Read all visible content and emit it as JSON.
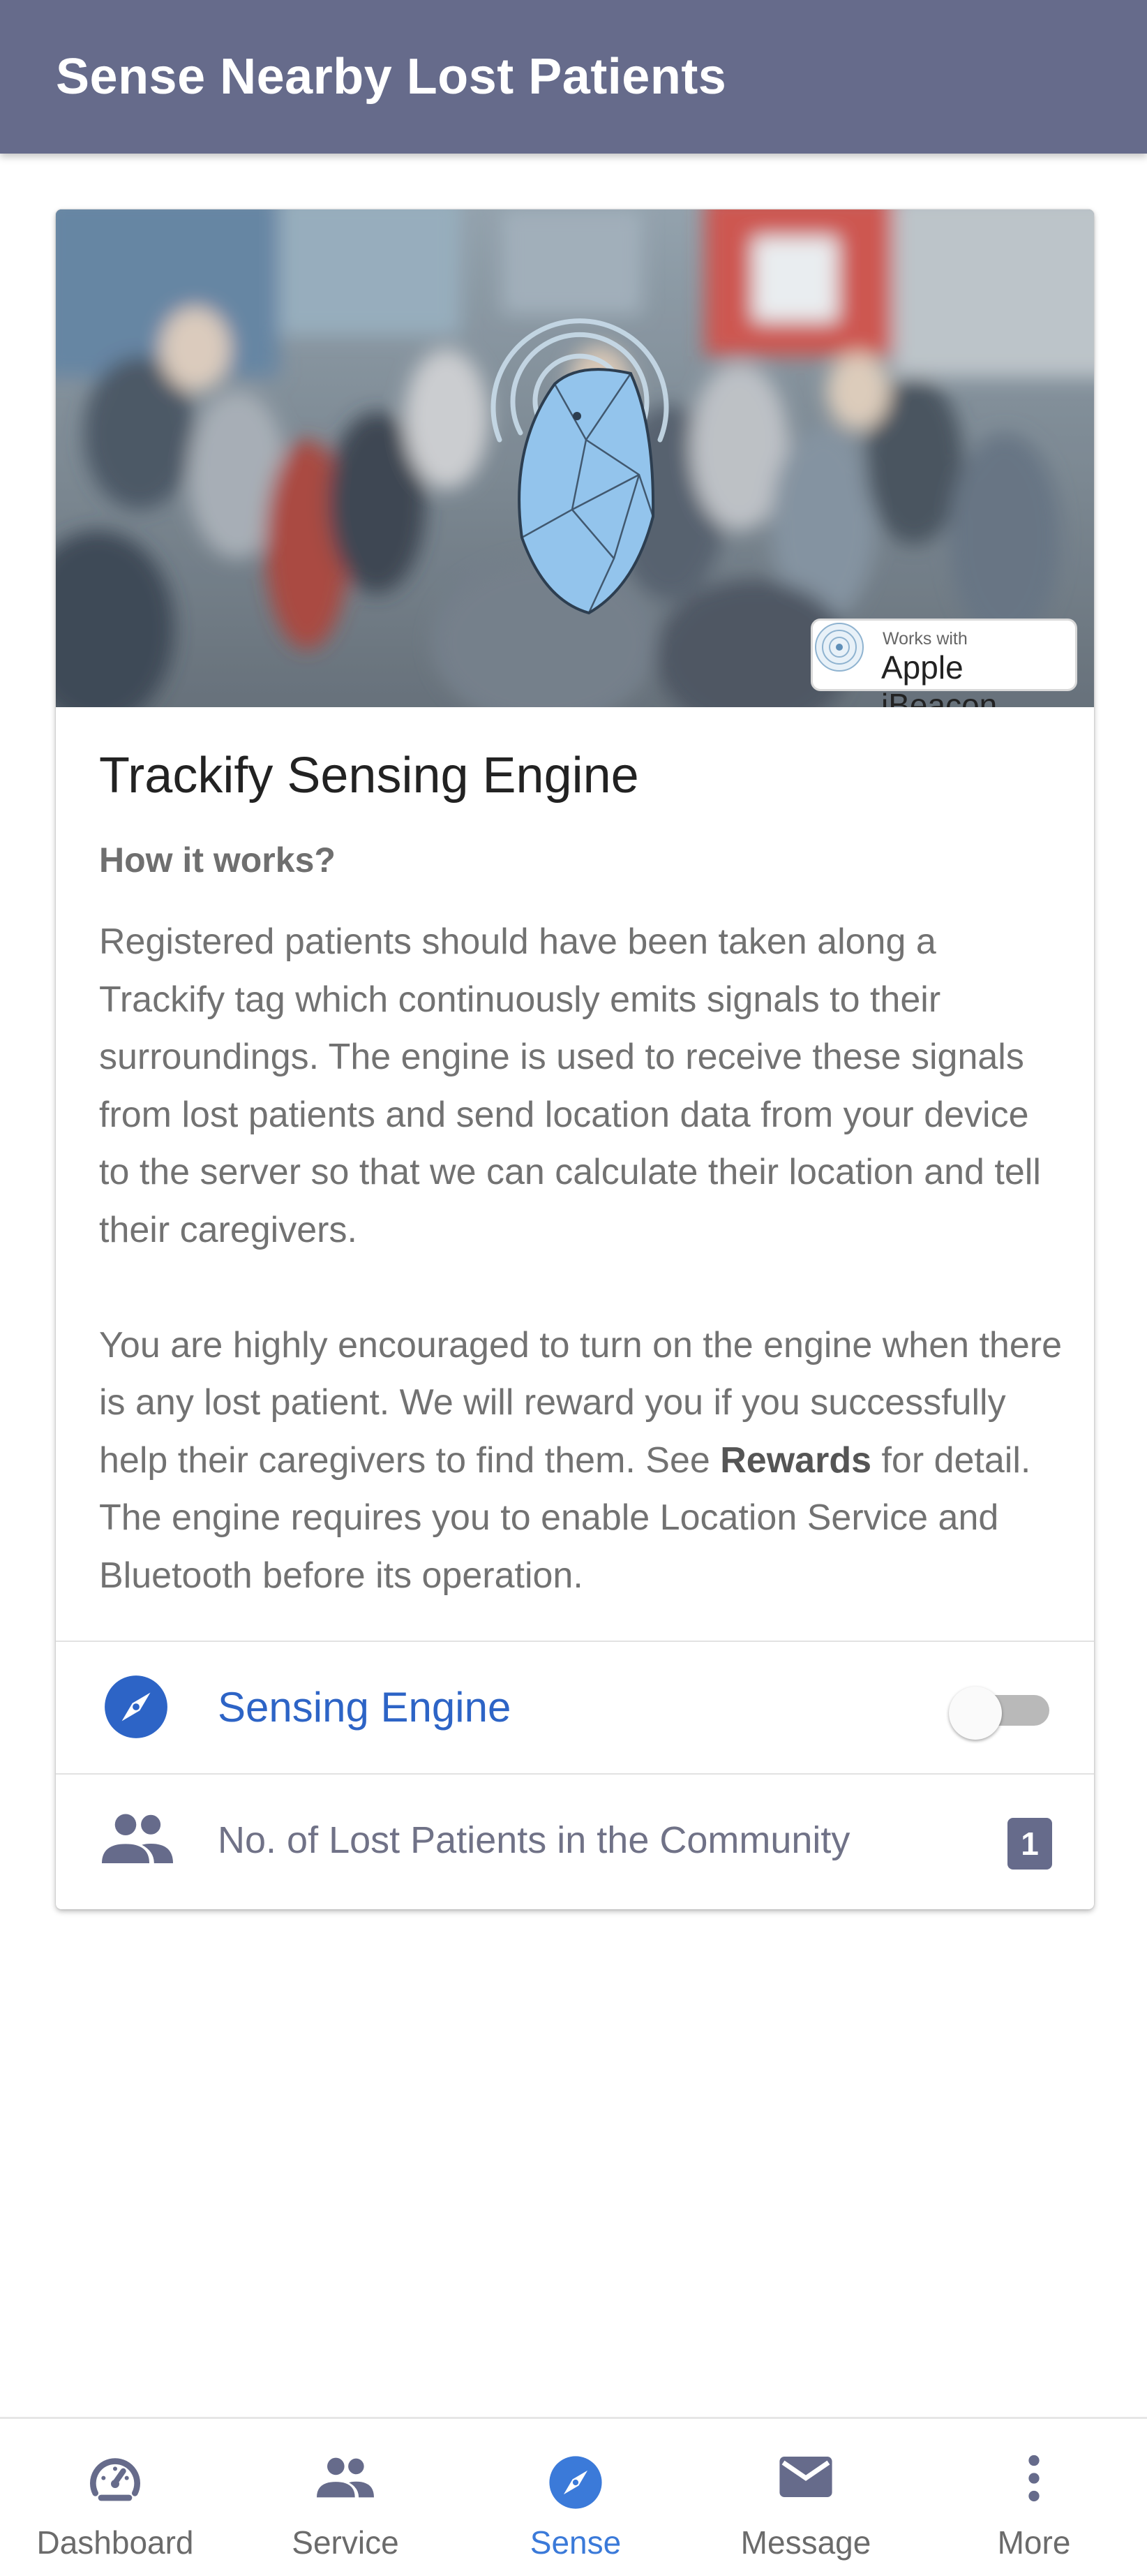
{
  "app_bar": {
    "title": "Sense Nearby Lost Patients"
  },
  "hero": {
    "badge_small": "Works with",
    "badge_big": "Apple iBeacon",
    "beacon_color": "#93c4ec"
  },
  "card": {
    "title": "Trackify Sensing Engine",
    "subtitle": "How it works?",
    "paragraph1": "Registered patients should have been taken along a Trackify tag which continuously emits signals to their surroundings. The engine is used to receive these signals from lost patients and send location data from your device to the server so that we can calculate their location and tell their caregivers.",
    "paragraph2_before": "You are highly encouraged to turn on the engine when there is any lost patient. We will reward you if you successfully help their caregivers to find them. See ",
    "paragraph2_bold": "Rewards",
    "paragraph2_after": " for detail. The engine requires you to enable Location Service and Bluetooth before its operation."
  },
  "engine_row": {
    "icon": "compass-icon",
    "label": "Sensing Engine",
    "enabled": false
  },
  "patients_row": {
    "icon": "people-icon",
    "label": "No. of Lost Patients in the Community",
    "count": "1"
  },
  "bottom_nav": {
    "items": [
      {
        "icon": "speedometer-icon",
        "label": "Dashboard",
        "active": false
      },
      {
        "icon": "people-icon",
        "label": "Service",
        "active": false
      },
      {
        "icon": "compass-icon",
        "label": "Sense",
        "active": true
      },
      {
        "icon": "mail-icon",
        "label": "Message",
        "active": false
      },
      {
        "icon": "more-vert-icon",
        "label": "More",
        "active": false
      }
    ]
  },
  "colors": {
    "app_bar": "#666b8b",
    "accent_blue": "#2d64c6",
    "nav_active": "#3b7ad9"
  }
}
